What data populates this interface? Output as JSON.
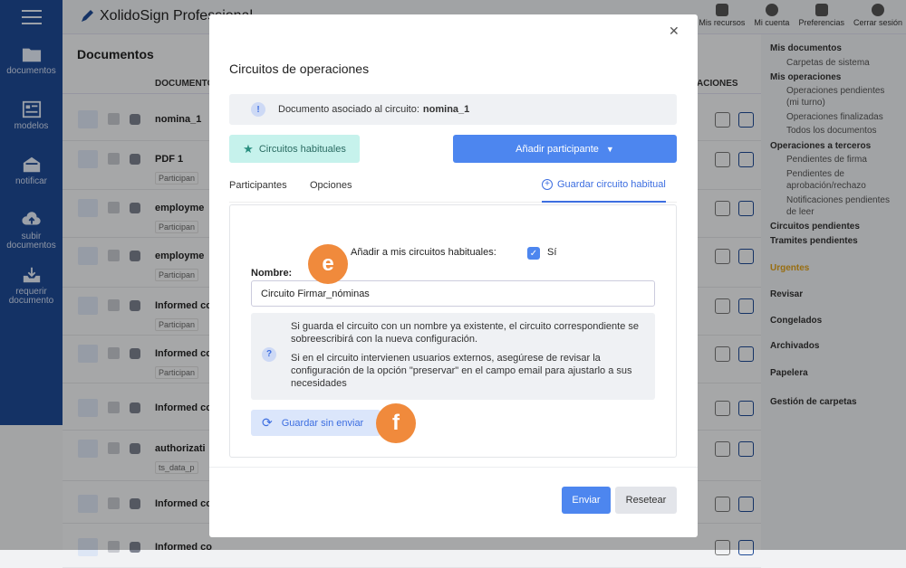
{
  "app": {
    "title": "XolidoSign Professional"
  },
  "left_nav": [
    {
      "label": "documentos",
      "icon": "folder-icon"
    },
    {
      "label": "modelos",
      "icon": "template-icon"
    },
    {
      "label": "notificar",
      "icon": "notify-icon"
    },
    {
      "label": "subir documentos",
      "icon": "upload-icon"
    },
    {
      "label": "requerir documento",
      "icon": "request-icon"
    }
  ],
  "topbar": [
    {
      "label": "Mis recursos"
    },
    {
      "label": "Mi cuenta"
    },
    {
      "label": "Preferencias"
    },
    {
      "label": "Cerrar sesión"
    }
  ],
  "doclist": {
    "title": "Documentos",
    "col_docs": "DOCUMENTOS",
    "col_ops": "ACIONES",
    "rows": [
      {
        "name": "nomina_1",
        "sub": ""
      },
      {
        "name": "PDF 1",
        "sub": "Participan"
      },
      {
        "name": "employme",
        "sub": "Participan"
      },
      {
        "name": "employme",
        "sub": "Participan"
      },
      {
        "name": "Informed co",
        "sub": "Participan"
      },
      {
        "name": "Informed co",
        "sub": "Participan"
      },
      {
        "name": "Informed co",
        "sub": ""
      },
      {
        "name": "authorizati",
        "sub": "ts_data_p"
      },
      {
        "name": "Informed co",
        "sub": ""
      },
      {
        "name": "Informed co",
        "sub": ""
      }
    ]
  },
  "right_panel": [
    {
      "label": "Mis documentos",
      "style": "b"
    },
    {
      "label": "Carpetas de sistema",
      "style": "s"
    },
    {
      "label": "Mis operaciones",
      "style": "b"
    },
    {
      "label": "Operaciones pendientes",
      "style": "s"
    },
    {
      "label": "(mi turno)",
      "style": "s"
    },
    {
      "label": "Operaciones finalizadas",
      "style": "s"
    },
    {
      "label": "Todos los documentos",
      "style": "s"
    },
    {
      "label": "Operaciones a terceros",
      "style": "b"
    },
    {
      "label": "Pendientes de firma",
      "style": "s"
    },
    {
      "label": "Pendientes de",
      "style": "s"
    },
    {
      "label": "aprobación/rechazo",
      "style": "s"
    },
    {
      "label": "Notificaciones pendientes",
      "style": "s"
    },
    {
      "label": "de leer",
      "style": "s"
    },
    {
      "label": "Circuitos pendientes",
      "style": "b"
    },
    {
      "label": "Tramites pendientes",
      "style": "b"
    },
    {
      "label": "Urgentes",
      "style": "b"
    },
    {
      "label": "Revisar",
      "style": "b"
    },
    {
      "label": "Congelados",
      "style": "b"
    },
    {
      "label": "Archivados",
      "style": "b"
    },
    {
      "label": "Papelera",
      "style": "b"
    },
    {
      "label": "Gestión de carpetas",
      "style": "b"
    }
  ],
  "colors": {
    "accent": "#4d86ef",
    "nav": "#1e4a95",
    "urgent": "#e0a21a",
    "marker": "#f08a3c"
  },
  "modal": {
    "title": "Circuitos de operaciones",
    "info_prefix": "Documento asociado al circuito:",
    "info_doc": "nomina_1",
    "habit_btn": "Circuitos habituales",
    "add_btn": "Añadir participante",
    "tabs": {
      "participants": "Participantes",
      "options": "Opciones",
      "save": "Guardar circuito habitual"
    },
    "add_to_habitual_label": "Añadir a mis circuitos habituales:",
    "add_to_habitual_value": "Sí",
    "name_label": "Nombre:",
    "name_value": "Circuito Firmar_nóminas",
    "help_1": "Si guarda el circuito con un nombre ya existente, el circuito correspondiente se sobreescribirá con la nueva configuración.",
    "help_2": "Si en el circuito intervienen usuarios externos, asegúrese de revisar la configuración de la opción \"preservar\" en el campo email para ajustarlo a sus necesidades",
    "save_btn": "Guardar sin enviar",
    "send_btn": "Enviar",
    "reset_btn": "Resetear"
  },
  "markers": {
    "e": "e",
    "f": "f"
  }
}
